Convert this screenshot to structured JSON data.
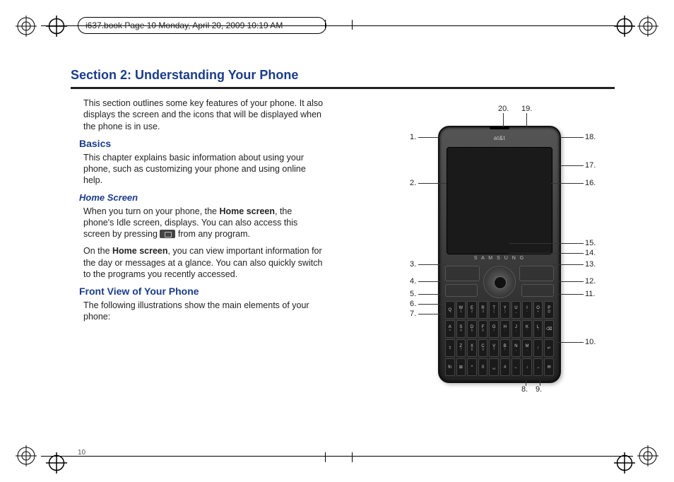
{
  "header": {
    "doc_info": "i637.book  Page 10  Monday, April 20, 2009  10:19 AM"
  },
  "title": "Section 2:  Understanding Your Phone",
  "intro": "This section outlines some key features of your phone. It also displays the screen and the icons that will be displayed when the phone is in use.",
  "basics": {
    "heading": "Basics",
    "text": "This chapter explains basic information about using your phone, such as customizing your phone and using online help."
  },
  "home_screen": {
    "heading": "Home Screen",
    "p1_a": "When you turn on your phone, the ",
    "p1_bold": "Home screen",
    "p1_b": ", the phone's Idle screen, displays. You can also access this screen by pressing ",
    "p1_c": " from any program.",
    "p2_a": "On the ",
    "p2_bold": "Home screen",
    "p2_b": ", you can view important information for the day or messages at a glance. You can also quickly switch to the programs you recently accessed."
  },
  "front_view": {
    "heading": "Front View of Your Phone",
    "text": "The following illustrations show the main elements of your phone:"
  },
  "page_number": "10",
  "phone": {
    "carrier": "at&t",
    "brand": "S A M S U N G",
    "keys_row1": [
      "Q",
      "W 1",
      "E 2",
      "R 3",
      "T (",
      "Y )",
      "U _",
      "I -",
      "O +",
      "P @"
    ],
    "keys_row2": [
      "A =",
      "S 4",
      "D 5",
      "F 6",
      "G /",
      "H :",
      "J ;",
      "K '",
      "L \"",
      "⌫"
    ],
    "keys_row3": [
      "⇧",
      "Z 7",
      "X 8",
      "C 9",
      "V ?",
      "B !",
      "N ,",
      "M .",
      "↑",
      "↵"
    ],
    "keys_row4": [
      "fn",
      "⊞",
      "*",
      "0",
      "␣",
      "#",
      "←",
      "↓",
      "→",
      "✉"
    ]
  },
  "callouts": {
    "c1": "1.",
    "c2": "2.",
    "c3": "3.",
    "c4": "4.",
    "c5": "5.",
    "c6": "6.",
    "c7": "7.",
    "c8": "8.",
    "c9": "9.",
    "c10": "10.",
    "c11": "11.",
    "c12": "12.",
    "c13": "13.",
    "c14": "14.",
    "c15": "15.",
    "c16": "16.",
    "c17": "17.",
    "c18": "18.",
    "c19": "19.",
    "c20": "20."
  }
}
